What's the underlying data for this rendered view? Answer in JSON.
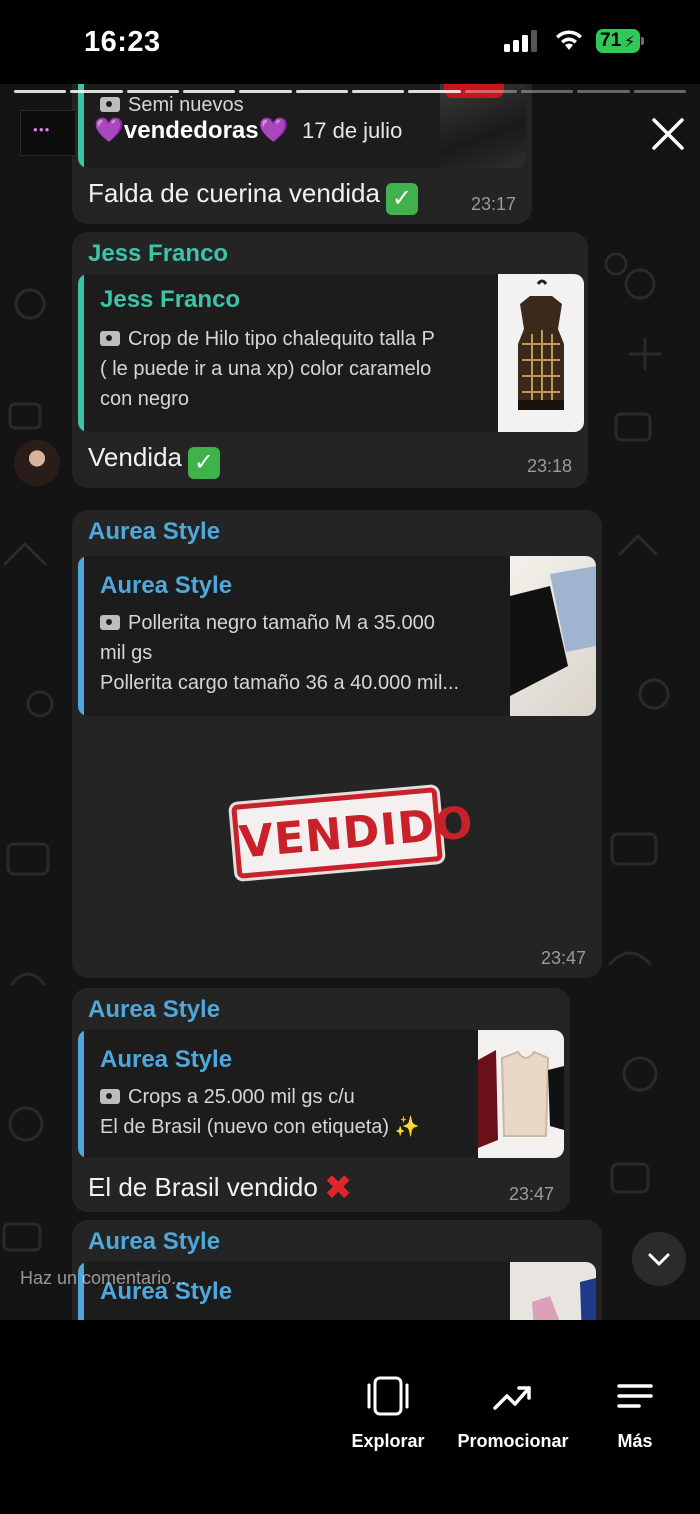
{
  "status": {
    "time": "16:23",
    "battery": "71"
  },
  "story": {
    "user": "vendedoras",
    "user_prefix_emoji": "💜",
    "user_suffix_emoji": "💜",
    "date": "17 de julio",
    "overlap_text": "Semi nuevos"
  },
  "messages": [
    {
      "text": "Falda de cuerina vendida",
      "time": "23:17"
    },
    {
      "sender": "Jess Franco",
      "quote_name": "Jess Franco",
      "quote_lines": [
        "Crop de Hilo tipo chalequito talla P",
        "( le puede ir a una xp) color caramelo",
        "con negro"
      ],
      "text": "Vendida",
      "time": "23:18"
    },
    {
      "sender": "Aurea Style",
      "quote_name": "Aurea Style",
      "quote_lines": [
        "Pollerita negro tamaño M a 35.000",
        "mil gs",
        "Pollerita cargo tamaño 36 a 40.000 mil..."
      ],
      "sticker": "VENDIDO",
      "time": "23:47"
    },
    {
      "sender": "Aurea Style",
      "quote_name": "Aurea Style",
      "quote_lines": [
        "Crops a 25.000 mil gs c/u",
        "El de Brasil (nuevo con etiqueta) ✨"
      ],
      "text": "El de Brasil vendido",
      "time": "23:47"
    },
    {
      "sender": "Aurea Style",
      "quote_name": "Aurea Style"
    }
  ],
  "comment_placeholder": "Haz un comentario...",
  "nav": {
    "explore": "Explorar",
    "promote": "Promocionar",
    "more": "Más"
  },
  "colors": {
    "teal": "#3cc4a6",
    "blue": "#4fa8db",
    "battery": "#32c759"
  }
}
